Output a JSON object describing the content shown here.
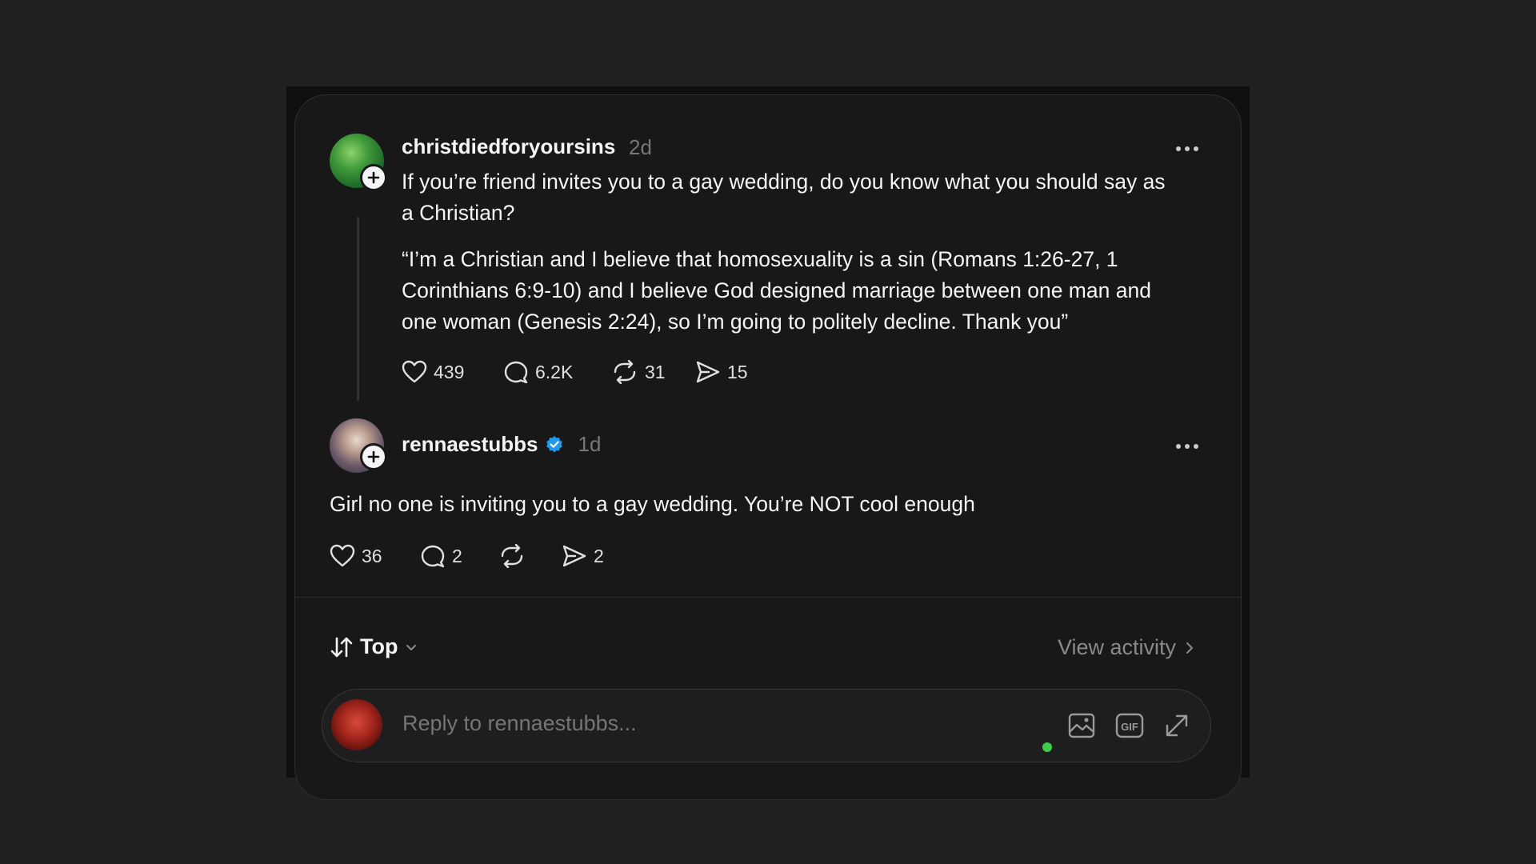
{
  "post": {
    "username": "christdiedforyoursins",
    "time": "2d",
    "text_line1": "If you’re friend invites you to a gay wedding, do you know what you should say as",
    "text_line2": "a Christian?",
    "quote_line1": "“I’m a Christian and I believe that homosexuality is a sin (Romans 1:26-27, 1",
    "quote_line2": "Corinthians 6:9-10) and I believe God designed marriage between one man and",
    "quote_line3": "one woman (Genesis 2:24), so I’m going to politely decline. Thank you”",
    "likes": "439",
    "comments": "6.2K",
    "reposts": "31",
    "shares": "15"
  },
  "reply": {
    "username": "rennaestubbs",
    "verified": true,
    "time": "1d",
    "text": "Girl no one is inviting you to a gay wedding. You’re NOT cool enough",
    "likes": "36",
    "comments": "2",
    "shares": "2"
  },
  "sort": {
    "label": "Top"
  },
  "activity": {
    "label": "View activity"
  },
  "composer": {
    "placeholder": "Reply to rennaestubbs..."
  },
  "colors": {
    "background": "#212121",
    "card": "#181818",
    "text": "#f3f5f7",
    "muted": "#777777",
    "verified": "#1d9bf0",
    "online": "#3ecf4a"
  }
}
